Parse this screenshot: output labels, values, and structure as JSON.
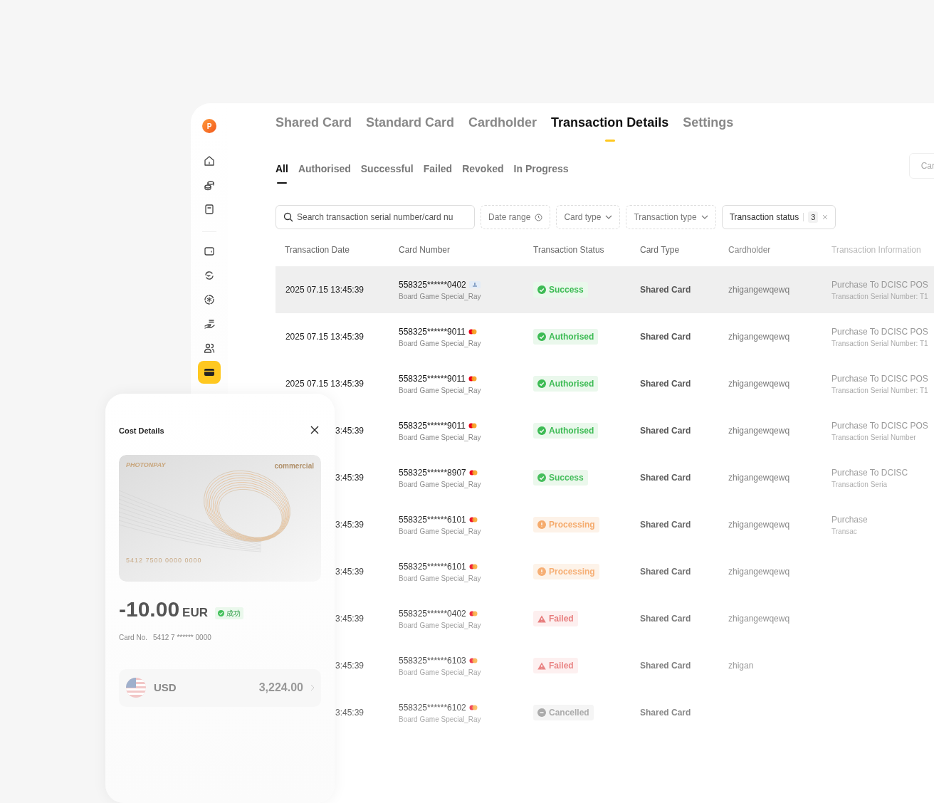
{
  "sidebar": {
    "logo": "P",
    "items": [
      {
        "kind": "home",
        "selected": false
      },
      {
        "kind": "coins",
        "selected": false
      },
      {
        "kind": "document",
        "selected": false
      },
      {
        "kind": "wallet",
        "selected": false
      },
      {
        "kind": "exchange",
        "selected": false
      },
      {
        "kind": "asterisk",
        "selected": false
      },
      {
        "kind": "hand",
        "selected": false
      },
      {
        "kind": "users",
        "selected": false
      },
      {
        "kind": "card",
        "selected": true
      }
    ]
  },
  "tabs": [
    {
      "label": "Shared Card",
      "selected": false
    },
    {
      "label": "Standard Card",
      "selected": false
    },
    {
      "label": "Cardholder",
      "selected": false
    },
    {
      "label": "Transaction Details",
      "selected": true
    },
    {
      "label": "Settings",
      "selected": false
    }
  ],
  "subtabs": [
    {
      "label": "All",
      "selected": true
    },
    {
      "label": "Authorised",
      "selected": false
    },
    {
      "label": "Successful",
      "selected": false
    },
    {
      "label": "Failed",
      "selected": false
    },
    {
      "label": "Revoked",
      "selected": false
    },
    {
      "label": "In Progress",
      "selected": false
    }
  ],
  "corner_button": "Car",
  "filters": {
    "search": {
      "placeholder": "Search transaction serial number/card nu"
    },
    "date": "Date range",
    "card_type": "Card type",
    "transaction_type": "Transaction type",
    "status": {
      "label": "Transaction status",
      "count": "3"
    }
  },
  "table": {
    "columns": [
      "Transaction Date",
      "Card Number",
      "Transaction Status",
      "Card Type",
      "Cardholder",
      "Transaction Information"
    ],
    "rows": [
      {
        "selected": true,
        "date": "2025 07.15 13:45:39",
        "card": "558325******0402",
        "brand": {
          "kind": "bank"
        },
        "card_name": "Board Game Special_Ray",
        "status": "Success",
        "kind": "success",
        "card_type": "Shared Card",
        "holder": "zhigangewqewq",
        "info": "Purchase To DCISC POS",
        "serial": "Transaction Serial Number: T1"
      },
      {
        "selected": false,
        "date": "2025 07.15 13:45:39",
        "card": "558325******9011",
        "brand": {
          "kind": "mastercard"
        },
        "card_name": "Board Game Special_Ray",
        "status": "Authorised",
        "kind": "success",
        "card_type": "Shared Card",
        "holder": "zhigangewqewq",
        "info": "Purchase To DCISC POS",
        "serial": "Transaction Serial Number: T1"
      },
      {
        "selected": false,
        "date": "2025 07.15 13:45:39",
        "card": "558325******9011",
        "brand": {
          "kind": "mastercard"
        },
        "card_name": "Board Game Special_Ray",
        "status": "Authorised",
        "kind": "success",
        "card_type": "Shared Card",
        "holder": "zhigangewqewq",
        "info": "Purchase To DCISC POS",
        "serial": "Transaction Serial Number: T1"
      },
      {
        "selected": false,
        "date": "3:45:39",
        "card": "558325******9011",
        "brand": {
          "kind": "mastercard"
        },
        "card_name": "Board Game Special_Ray",
        "status": "Authorised",
        "kind": "success",
        "card_type": "Shared Card",
        "holder": "zhigangewqewq",
        "info": "Purchase To DCISC POS",
        "serial": "Transaction Serial Number"
      },
      {
        "selected": false,
        "date": "3:45:39",
        "card": "558325******8907",
        "brand": {
          "kind": "mastercard"
        },
        "card_name": "Board Game Special_Ray",
        "status": "Success",
        "kind": "success",
        "card_type": "Shared Card",
        "holder": "zhigangewqewq",
        "info": "Purchase To DCISC",
        "serial": "Transaction Seria"
      },
      {
        "selected": false,
        "date": "3:45:39",
        "card": "558325******6101",
        "brand": {
          "kind": "mastercard"
        },
        "card_name": "Board Game Special_Ray",
        "status": "Processing",
        "kind": "processing",
        "card_type": "Shared Card",
        "holder": "zhigangewqewq",
        "info": "Purchase",
        "serial": "Transac"
      },
      {
        "selected": false,
        "date": "3:45:39",
        "card": "558325******6101",
        "brand": {
          "kind": "mastercard"
        },
        "card_name": "Board Game Special_Ray",
        "status": "Processing",
        "kind": "processing",
        "card_type": "Shared Card",
        "holder": "zhigangewqewq"
      },
      {
        "selected": false,
        "date": "3:45:39",
        "card": "558325******0402",
        "brand": {
          "kind": "mastercard"
        },
        "card_name": "Board Game Special_Ray",
        "status": "Failed",
        "kind": "failed",
        "card_type": "Shared Card",
        "holder": "zhigangewqewq"
      },
      {
        "selected": false,
        "date": "3:45:39",
        "card": "558325******6103",
        "brand": {
          "kind": "mastercard"
        },
        "card_name": "Board Game Special_Ray",
        "status": "Failed",
        "kind": "failed",
        "card_type": "Shared Card",
        "holder": "zhigan"
      },
      {
        "selected": false,
        "date": "3:45:39",
        "card": "558325******6102",
        "brand": {
          "kind": "mastercard"
        },
        "card_name": "Board Game Special_Ray",
        "status": "Cancelled",
        "kind": "cancelled",
        "card_type": "Shared Card"
      }
    ]
  },
  "cost_details": {
    "title": "Cost Details",
    "card": {
      "brand": "PHOTONPAY",
      "tier": "commercial",
      "number": "5412 7500 0000 0000"
    },
    "amount": "-10.00",
    "currency": "EUR",
    "status": "成功",
    "card_no_label": "Card No.",
    "card_no": "5412 7 ****** 0000",
    "account": {
      "currency": "USD",
      "balance": "3,224.00"
    }
  }
}
